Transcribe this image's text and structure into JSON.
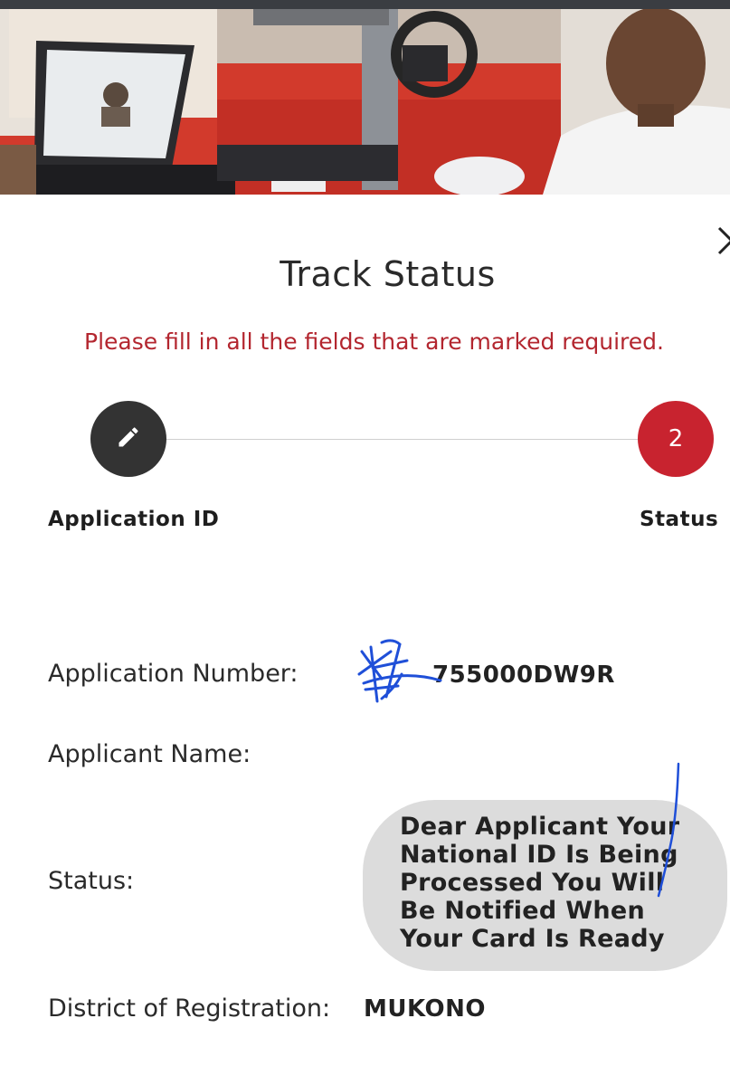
{
  "page": {
    "title": "Track Status",
    "warning": "Please fill in all the fields that are marked required."
  },
  "stepper": {
    "step1_label": "Application ID",
    "step2_number": "2",
    "step2_label": "Status"
  },
  "details": {
    "application_number_label": "Application Number:",
    "application_number_value": "755000DW9R",
    "applicant_name_label": "Applicant Name:",
    "status_label": "Status:",
    "status_value": "Dear Applicant Your National ID Is Being Processed You Will Be Notified When Your Card Is Ready",
    "district_label": "District of Registration:",
    "district_value": "MUKONO"
  },
  "colors": {
    "accent_red": "#c8232f",
    "step_done": "#333333",
    "bubble": "#dcdcdc",
    "ink_scribble": "#1f4fd8"
  },
  "icons": {
    "step1": "pencil-icon",
    "close": "close-icon"
  }
}
